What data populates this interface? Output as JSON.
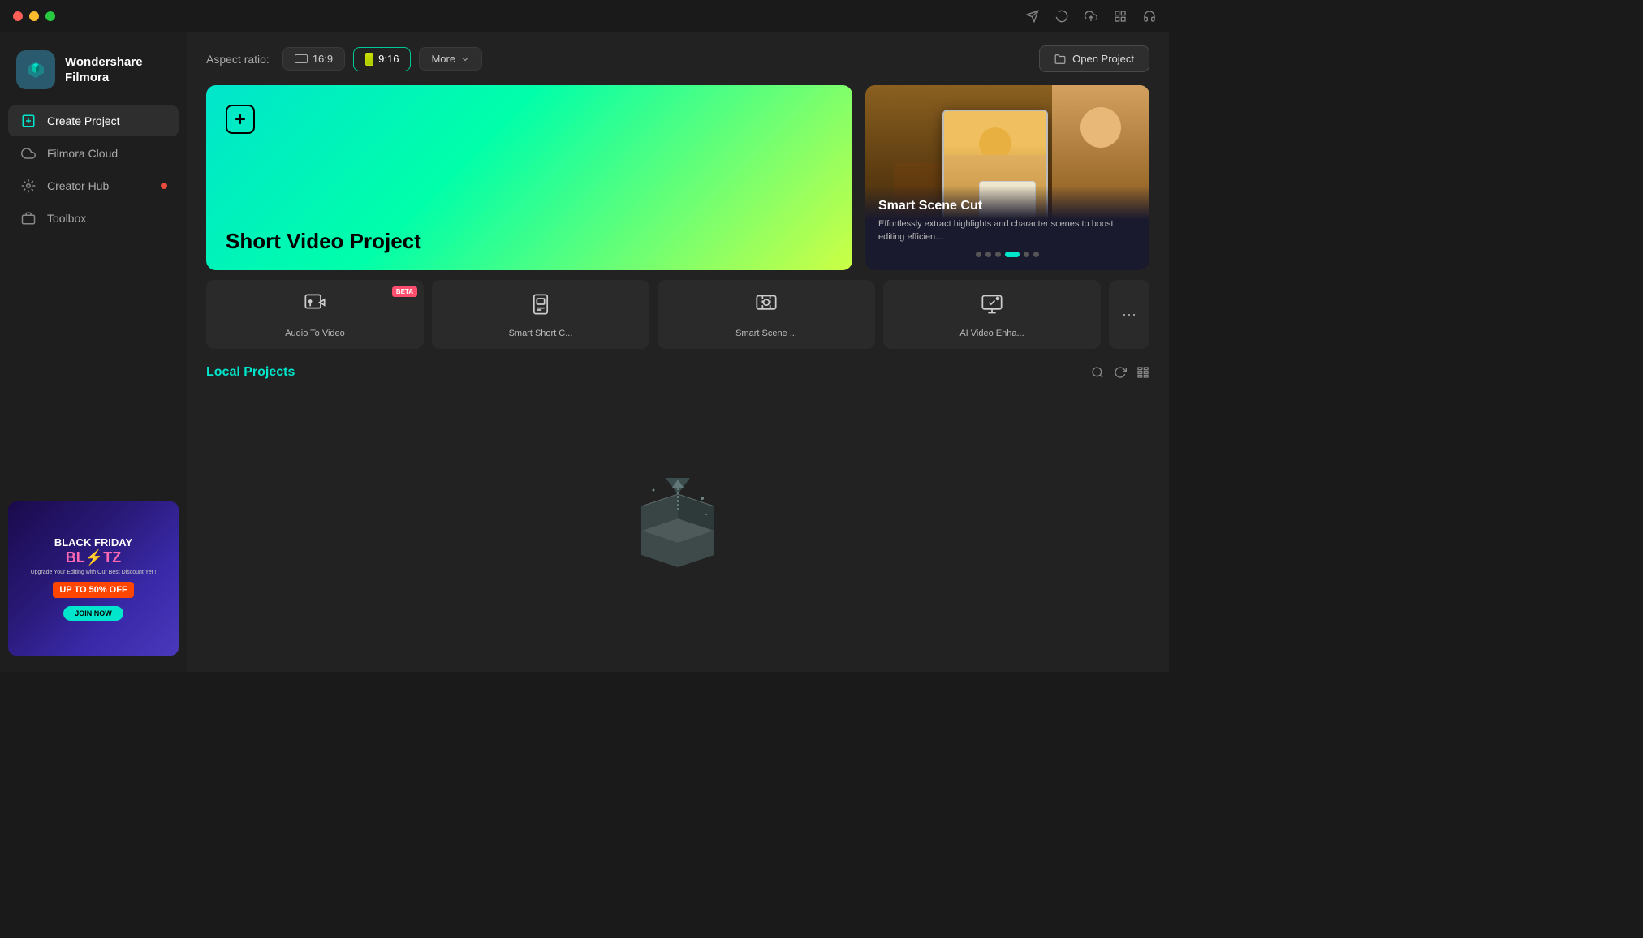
{
  "app": {
    "name": "Wondershare Filmora"
  },
  "titlebar": {
    "icons": [
      "send-icon",
      "loading-icon",
      "upload-icon",
      "grid-icon",
      "headphone-icon"
    ]
  },
  "sidebar": {
    "logo_line1": "Wondershare",
    "logo_line2": "Filmora",
    "nav_items": [
      {
        "id": "create-project",
        "label": "Create Project",
        "active": true
      },
      {
        "id": "filmora-cloud",
        "label": "Filmora Cloud",
        "active": false
      },
      {
        "id": "creator-hub",
        "label": "Creator Hub",
        "active": false,
        "badge": true
      },
      {
        "id": "toolbox",
        "label": "Toolbox",
        "active": false
      }
    ],
    "ad": {
      "line1": "BLACK FRIDAY",
      "line2": "BL⚡TZ",
      "subtitle": "Upgrade Your Editing with Our Best Discount Yet !",
      "discount": "UP TO 50% OFF",
      "cta": "JOIN NOW"
    }
  },
  "topbar": {
    "aspect_ratio_label": "Aspect ratio:",
    "aspect_options": [
      {
        "id": "16-9",
        "label": "16:9",
        "active": false
      },
      {
        "id": "9-16",
        "label": "9:16",
        "active": true
      }
    ],
    "more_label": "More",
    "open_project_label": "Open Project"
  },
  "hero": {
    "title": "Short Video Project",
    "card_icon": "+"
  },
  "promo": {
    "title": "Smart Scene Cut",
    "description": "Effortlessly extract highlights and character scenes to boost editing efficien…",
    "dots": [
      false,
      false,
      false,
      true,
      false,
      false
    ]
  },
  "tools": [
    {
      "id": "audio-to-video",
      "label": "Audio To Video",
      "beta": true,
      "icon": "🎬"
    },
    {
      "id": "smart-short-cut",
      "label": "Smart Short C...",
      "beta": false,
      "icon": "📱"
    },
    {
      "id": "smart-scene-cut",
      "label": "Smart Scene ...",
      "beta": false,
      "icon": "🎭"
    },
    {
      "id": "ai-video-enhance",
      "label": "AI Video Enha...",
      "beta": false,
      "icon": "✨"
    }
  ],
  "local_projects": {
    "title": "Local Projects",
    "empty_state_icon": "📦"
  }
}
